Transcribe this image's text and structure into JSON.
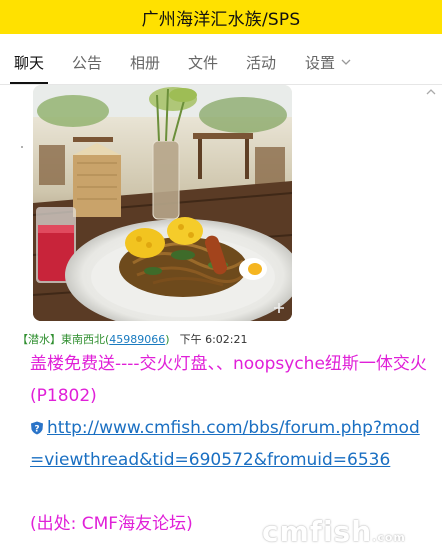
{
  "window": {
    "title": "广州海洋汇水族/SPS"
  },
  "tabs": [
    {
      "label": "聊天"
    },
    {
      "label": "公告"
    },
    {
      "label": "相册"
    },
    {
      "label": "文件"
    },
    {
      "label": "活动"
    },
    {
      "label": "设置"
    }
  ],
  "post": {
    "sender_tag": "【潜水】",
    "sender_name": "東南西北",
    "sender_qq": "45989066",
    "timestamp": "下午 6:02:21",
    "title_text": "盖楼免费送----交火灯盘、、noopsyche纽斯一体交火(P1802)",
    "link_url": "http://www.cmfish.com/bbs/forum.php?mod=viewthread&tid=690572&fromuid=6536",
    "source_text": "(出处: CMF海友论坛)"
  },
  "watermark": {
    "main": "cmfish",
    "suffix": ".com"
  },
  "colors": {
    "title_bar": "#ffe100",
    "message_magenta": "#e020d8",
    "link_blue": "#1a6fc2",
    "sender_green": "#2f8f2f"
  },
  "icons": [
    "chevron-down-icon",
    "scroll-up-icon",
    "question-shield-icon",
    "photo-plus-icon"
  ]
}
